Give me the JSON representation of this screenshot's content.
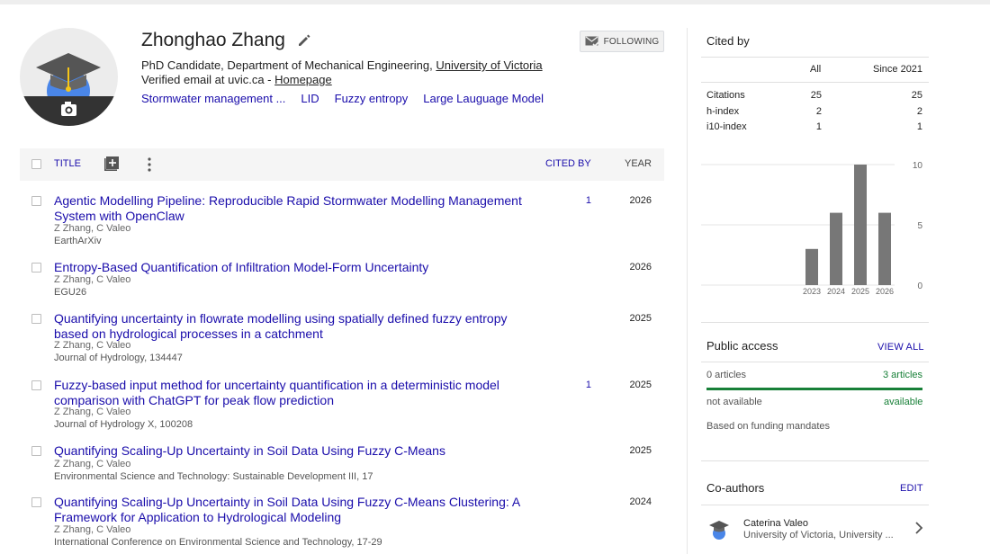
{
  "profile": {
    "name": "Zhonghao Zhang",
    "affiliation_prefix": "PhD Candidate, Department of Mechanical Engineering, ",
    "affiliation_link": "University of Victoria",
    "verified_prefix": "Verified email at uvic.ca - ",
    "homepage": "Homepage",
    "interests": [
      "Stormwater management ...",
      "LID",
      "Fuzzy entropy",
      "Large Lauguage Model"
    ],
    "follow_label": "FOLLOWING"
  },
  "table": {
    "title_label": "TITLE",
    "cited_by_label": "CITED BY",
    "year_label": "YEAR",
    "rows": [
      {
        "title": "Agentic Modelling Pipeline: Reproducible Rapid Stormwater Modelling Management System with OpenClaw",
        "authors": "Z Zhang, C Valeo",
        "venue": "EarthArXiv",
        "cited": "1",
        "year": "2026"
      },
      {
        "title": "Entropy-Based Quantification of Infiltration Model-Form Uncertainty",
        "authors": "Z Zhang, C Valeo",
        "venue": "EGU26",
        "cited": "",
        "year": "2026"
      },
      {
        "title": "Quantifying uncertainty in flowrate modelling using spatially defined fuzzy entropy based on hydrological processes in a catchment",
        "authors": "Z Zhang, C Valeo",
        "venue": "Journal of Hydrology, 134447",
        "cited": "",
        "year": "2025"
      },
      {
        "title": "Fuzzy-based input method for uncertainty quantification in a deterministic model comparison with ChatGPT for peak flow prediction",
        "authors": "Z Zhang, C Valeo",
        "venue": "Journal of Hydrology X, 100208",
        "cited": "1",
        "year": "2025"
      },
      {
        "title": "Quantifying Scaling-Up Uncertainty in Soil Data Using Fuzzy C-Means",
        "authors": "Z Zhang, C Valeo",
        "venue": "Environmental Science and Technology: Sustainable Development III, 17",
        "cited": "",
        "year": "2025"
      },
      {
        "title": "Quantifying Scaling-Up Uncertainty in Soil Data Using Fuzzy C-Means Clustering: A Framework for Application to Hydrological Modeling",
        "authors": "Z Zhang, C Valeo",
        "venue": "International Conference on Environmental Science and Technology, 17-29",
        "cited": "",
        "year": "2024"
      }
    ]
  },
  "cited_by": {
    "heading": "Cited by",
    "col_all": "All",
    "col_since": "Since 2021",
    "metrics": [
      {
        "label": "Citations",
        "all": "25",
        "since": "25"
      },
      {
        "label": "h-index",
        "all": "2",
        "since": "2"
      },
      {
        "label": "i10-index",
        "all": "1",
        "since": "1"
      }
    ]
  },
  "chart_data": {
    "type": "bar",
    "categories": [
      "2023",
      "2024",
      "2025",
      "2026"
    ],
    "values": [
      3,
      6,
      10,
      6
    ],
    "ylim": [
      0,
      10
    ],
    "yticks": [
      "0",
      "5",
      "10"
    ],
    "title": "",
    "xlabel": "",
    "ylabel": "",
    "bar_color": "#777777",
    "grid": true
  },
  "public_access": {
    "heading": "Public access",
    "view_all": "VIEW ALL",
    "not_available_count": "0 articles",
    "available_count": "3 articles",
    "not_available_label": "not available",
    "available_label": "available",
    "note": "Based on funding mandates"
  },
  "coauthors": {
    "heading": "Co-authors",
    "edit": "EDIT",
    "items": [
      {
        "name": "Caterina Valeo",
        "affiliation": "University of Victoria, University ..."
      }
    ]
  }
}
